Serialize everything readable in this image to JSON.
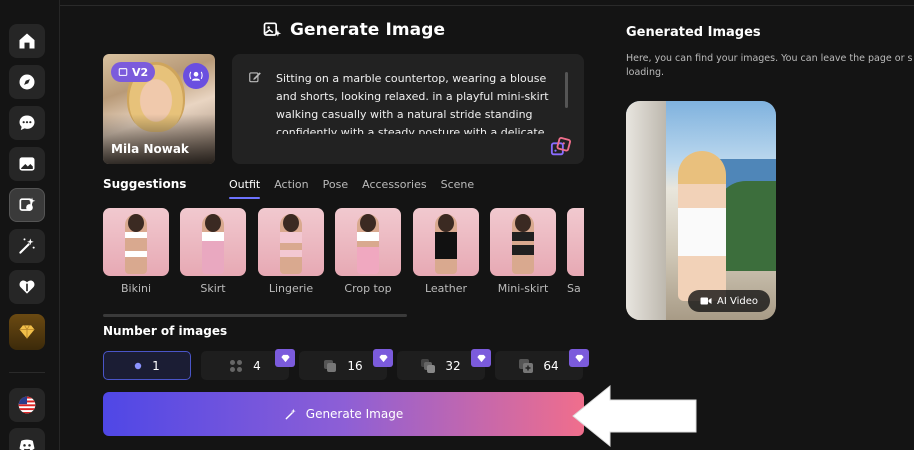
{
  "sidebar": {
    "items": [
      {
        "name": "home-icon"
      },
      {
        "name": "compass-icon"
      },
      {
        "name": "chat-icon"
      },
      {
        "name": "gallery-icon"
      },
      {
        "name": "generate-image-icon",
        "active": true
      },
      {
        "name": "magic-wand-icon"
      },
      {
        "name": "heart-icon"
      },
      {
        "name": "diamond-icon",
        "premium": true
      }
    ],
    "bottom": [
      {
        "name": "us-flag-icon"
      },
      {
        "name": "discord-icon"
      }
    ]
  },
  "header": {
    "title": "Generate Image"
  },
  "character": {
    "badge": "V2",
    "name": "Mila Nowak"
  },
  "prompt": {
    "text": "Sitting on a marble countertop, wearing a blouse and shorts, looking relaxed. in a playful mini-skirt walking casually with a natural stride standing confidently with a steady posture with a delicate necklace on a tranquil balcony with soft natural light and lush greenery"
  },
  "suggestions": {
    "label": "Suggestions",
    "tabs": [
      "Outfit",
      "Action",
      "Pose",
      "Accessories",
      "Scene"
    ],
    "active_tab": 0,
    "items": [
      {
        "label": "Bikini",
        "color": "#ffffff"
      },
      {
        "label": "Skirt",
        "color": "#e9a8c0"
      },
      {
        "label": "Lingerie",
        "color": "#f3c8d2"
      },
      {
        "label": "Crop top",
        "color": "#ffffff"
      },
      {
        "label": "Leather",
        "color": "#111111"
      },
      {
        "label": "Mini-skirt",
        "color": "#202020"
      },
      {
        "label": "Sa",
        "color": "#d9b9a0"
      }
    ]
  },
  "number_of_images": {
    "label": "Number of images",
    "options": [
      {
        "value": "1",
        "icon": "single-dot-icon",
        "active": true,
        "premium": false
      },
      {
        "value": "4",
        "icon": "grid-four-icon",
        "active": false,
        "premium": true
      },
      {
        "value": "16",
        "icon": "stack-icon",
        "active": false,
        "premium": true
      },
      {
        "value": "32",
        "icon": "stack-double-icon",
        "active": false,
        "premium": true
      },
      {
        "value": "64",
        "icon": "stack-plus-icon",
        "active": false,
        "premium": true
      }
    ]
  },
  "generate_button": {
    "label": "Generate Image"
  },
  "generated": {
    "title": "Generated Images",
    "description": "Here, you can find your images. You can leave the page or s",
    "description_line2": "loading.",
    "ai_video_label": "AI Video"
  },
  "colors": {
    "accent": "#6d73ff",
    "premium": "#7b5bdc",
    "gradient_start": "#4f47e6",
    "gradient_end": "#f06e8c"
  }
}
